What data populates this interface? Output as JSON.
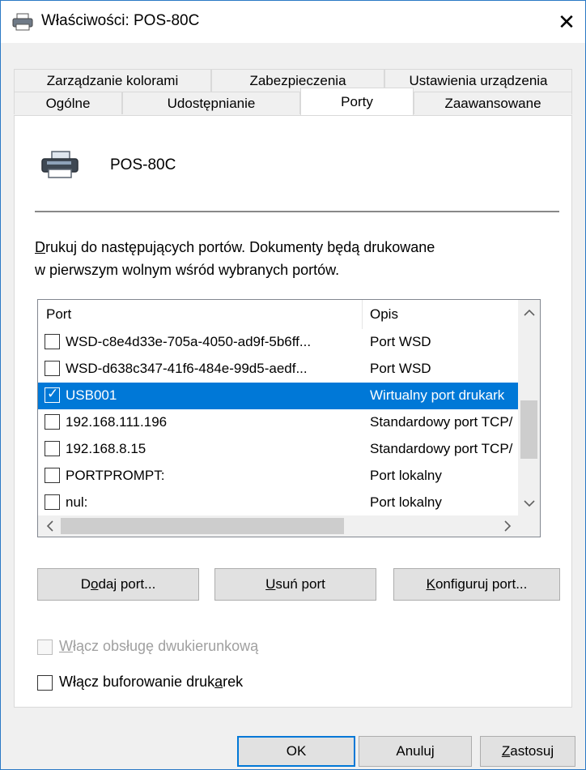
{
  "window": {
    "title": "Właściwości: POS-80C",
    "close_glyph": "✕"
  },
  "tabs": {
    "row1": [
      "Zarządzanie kolorami",
      "Zabezpieczenia",
      "Ustawienia urządzenia"
    ],
    "row2": [
      "Ogólne",
      "Udostępnianie",
      "Porty",
      "Zaawansowane"
    ],
    "active": "Porty"
  },
  "printer": {
    "name": "POS-80C",
    "icon": "printer-icon"
  },
  "description": {
    "line1_prefix": "D",
    "line1_rest": "rukuj do następujących portów. Dokumenty będą drukowane",
    "line2": "w pierwszym wolnym wśród wybranych portów."
  },
  "ports": {
    "col_port": "Port",
    "col_desc": "Opis",
    "rows": [
      {
        "port": "WSD-c8e4d33e-705a-4050-ad9f-5b6ff...",
        "desc": "Port WSD",
        "checked": false,
        "selected": false
      },
      {
        "port": "WSD-d638c347-41f6-484e-99d5-aedf...",
        "desc": "Port WSD",
        "checked": false,
        "selected": false
      },
      {
        "port": "USB001",
        "desc": "Wirtualny port drukark",
        "checked": true,
        "selected": true
      },
      {
        "port": "192.168.111.196",
        "desc": "Standardowy port TCP/",
        "checked": false,
        "selected": false
      },
      {
        "port": "192.168.8.15",
        "desc": "Standardowy port TCP/",
        "checked": false,
        "selected": false
      },
      {
        "port": "PORTPROMPT:",
        "desc": "Port lokalny",
        "checked": false,
        "selected": false
      },
      {
        "port": "nul:",
        "desc": "Port lokalny",
        "checked": false,
        "selected": false
      }
    ],
    "scroll_up": "^",
    "scroll_down": "v",
    "scroll_left": "<",
    "scroll_right": ">"
  },
  "buttons": {
    "add_a": "D",
    "add_u": "o",
    "add_b": "daj port...",
    "remove_u": "U",
    "remove_b": "suń port",
    "configure_u": "K",
    "configure_b": "onfiguruj port..."
  },
  "options": {
    "bidi_u": "W",
    "bidi_b": "łącz obsługę dwukierunkową",
    "spool_a": "Włącz buforowanie druk",
    "spool_u": "a",
    "spool_b": "rek"
  },
  "footer": {
    "ok": "OK",
    "cancel": "Anuluj",
    "apply_u": "Z",
    "apply_b": "astosuj"
  }
}
